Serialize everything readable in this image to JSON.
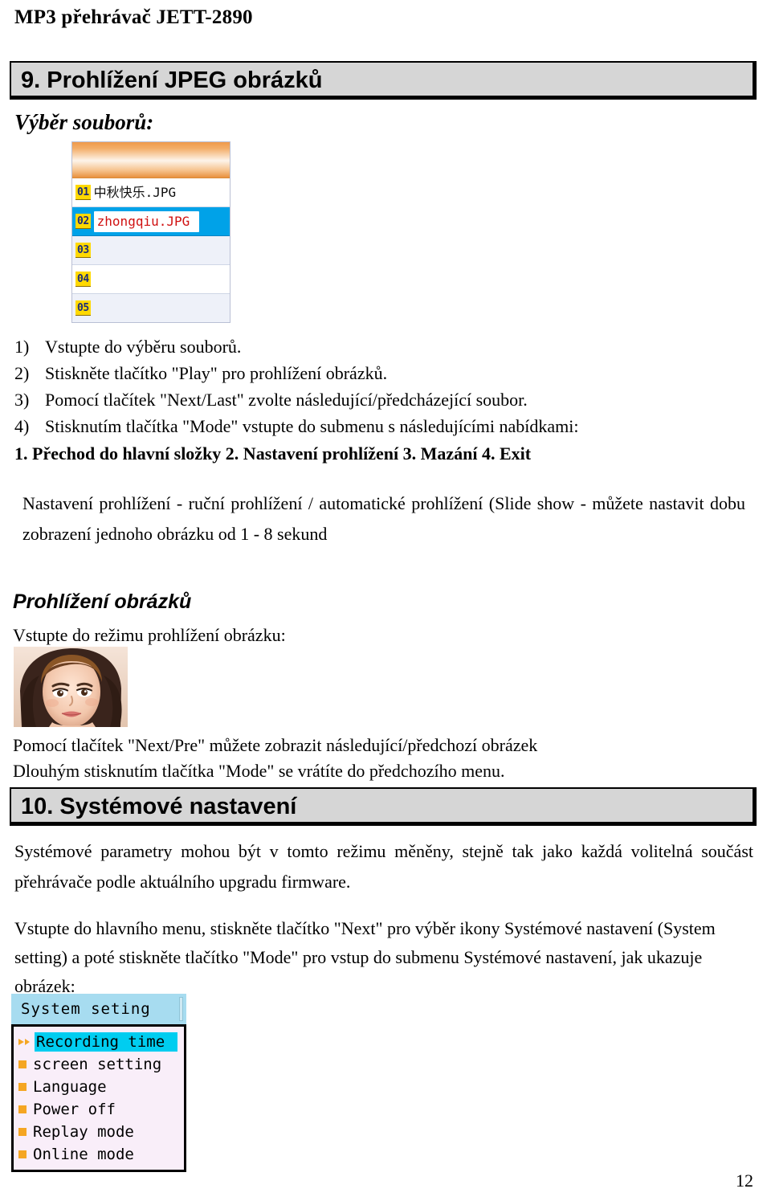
{
  "document": {
    "running_head": "MP3 přehrávač JETT-2890",
    "page_number": "12"
  },
  "sections": [
    {
      "id": "section-9",
      "heading": "9. Prohlížení JPEG obrázků",
      "subheading": "Výběr souborů:"
    },
    {
      "id": "section-10",
      "heading": "10. Systémové nastavení"
    }
  ],
  "file_list": {
    "title": "",
    "rows": [
      {
        "index": "01",
        "name": "中秋快乐.JPG",
        "selected": false
      },
      {
        "index": "02",
        "name": "zhongqiu.JPG",
        "selected": true
      },
      {
        "index": "03",
        "name": "",
        "selected": false
      },
      {
        "index": "04",
        "name": "",
        "selected": false
      },
      {
        "index": "05",
        "name": "",
        "selected": false
      }
    ],
    "colors": {
      "titlebar_orange": "#ef9a4a",
      "selection_blue": "#00a2e8",
      "badge_yellow": "#ffd900",
      "selected_text_red": "#d01010"
    }
  },
  "steps": {
    "items": [
      {
        "num": "1)",
        "text": "Vstupte do výběru souborů."
      },
      {
        "num": "2)",
        "text": "Stiskněte tlačítko \"Play\" pro prohlížení obrázků."
      },
      {
        "num": "3)",
        "text": "Pomocí tlačítek \"Next/Last\" zvolte následující/předcházející soubor."
      },
      {
        "num": "4)",
        "text": "Stisknutím tlačítka \"Mode\" vstupte do submenu s následujícími nabídkami:"
      }
    ],
    "submenu_line": "1. Přechod do hlavní složky 2. Nastavení prohlížení 3. Mazání 4. Exit"
  },
  "paragraphs": {
    "nastaveni_prohlizeni": "Nastavení prohlížení - ruční prohlížení / automatické prohlížení (Slide show - můžete nastavit dobu zobrazení jednoho obrázku od 1 - 8 sekund",
    "prohlizeni_obrazku_heading": "Prohlížení obrázků",
    "vstupte_rezim": "Vstupte do režimu prohlížení obrázku:",
    "pomoci_next_pre_line1": "Pomocí tlačítek \"Next/Pre\" můžete zobrazit následující/předchozí obrázek",
    "pomoci_next_pre_line2": "Dlouhým stisknutím tlačítka \"Mode\" se vrátíte do předchozího menu.",
    "systemove_parametry": "Systémové parametry mohou být v tomto režimu měněny, stejně tak jako každá volitelná součást přehrávače podle aktuálního upgradu firmware.",
    "vstupte_hlavni_menu": "Vstupte do hlavního menu, stiskněte tlačítko \"Next\" pro výběr ikony Systémové nastavení (System setting) a poté stiskněte tlačítko \"Mode\" pro vstup do submenu Systémové nastavení, jak ukazuje obrázek:"
  },
  "system_menu": {
    "title": "System seting",
    "items": [
      {
        "label": "Recording time",
        "highlighted": true
      },
      {
        "label": "screen setting",
        "highlighted": false
      },
      {
        "label": "Language",
        "highlighted": false
      },
      {
        "label": "Power off",
        "highlighted": false
      },
      {
        "label": "Replay mode",
        "highlighted": false
      },
      {
        "label": "Online mode",
        "highlighted": false
      }
    ],
    "colors": {
      "titlebar": "#a7dcf0",
      "body": "#f9eef9",
      "highlight": "#00cdf0",
      "bullet": "#f5a623"
    }
  }
}
